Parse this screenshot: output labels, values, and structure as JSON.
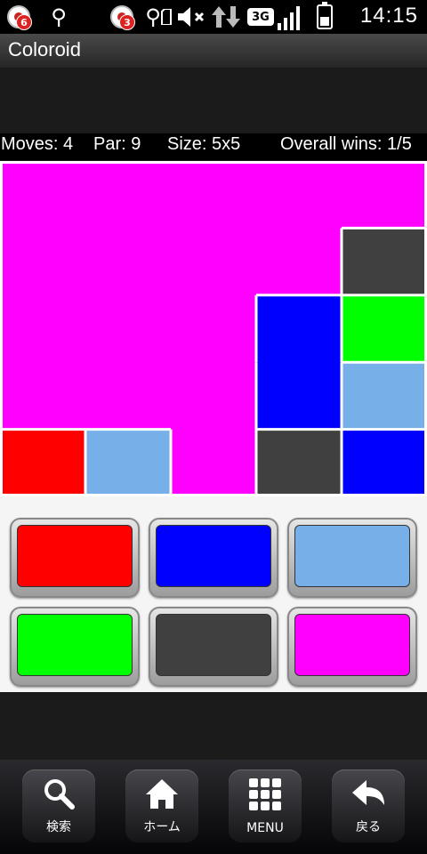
{
  "status_bar": {
    "time": "14:15",
    "notification_badges": [
      "6",
      "3"
    ],
    "network_label": "3G",
    "icons": [
      "notification-icon",
      "usb-icon",
      "notification-icon",
      "usb-icon",
      "sd-card-icon",
      "mute-icon",
      "data-arrows-icon",
      "signal-icon",
      "battery-icon"
    ]
  },
  "app": {
    "title": "Coloroid"
  },
  "stats": {
    "moves": "Moves: 4",
    "par": "Par: 9",
    "size": "Size: 5x5",
    "wins": "Overall wins: 1/5"
  },
  "colors": {
    "red": "#ff0000",
    "blue": "#0000ff",
    "lightblue": "#77b0e8",
    "green": "#00ff00",
    "darkgray": "#404040",
    "magenta": "#ff00ff"
  },
  "board": {
    "rows": 5,
    "cols": 5,
    "cells": [
      [
        "magenta",
        "magenta",
        "magenta",
        "magenta",
        "magenta"
      ],
      [
        "magenta",
        "magenta",
        "magenta",
        "magenta",
        "darkgray"
      ],
      [
        "magenta",
        "magenta",
        "magenta",
        "blue",
        "green"
      ],
      [
        "magenta",
        "magenta",
        "magenta",
        "blue",
        "lightblue"
      ],
      [
        "red",
        "lightblue",
        "magenta",
        "darkgray",
        "blue"
      ]
    ]
  },
  "palette": [
    "red",
    "blue",
    "lightblue",
    "green",
    "darkgray",
    "magenta"
  ],
  "nav": [
    {
      "label": "検索",
      "icon": "search-icon"
    },
    {
      "label": "ホーム",
      "icon": "home-icon"
    },
    {
      "label": "MENU",
      "icon": "menu-grid-icon"
    },
    {
      "label": "戻る",
      "icon": "back-icon"
    }
  ]
}
